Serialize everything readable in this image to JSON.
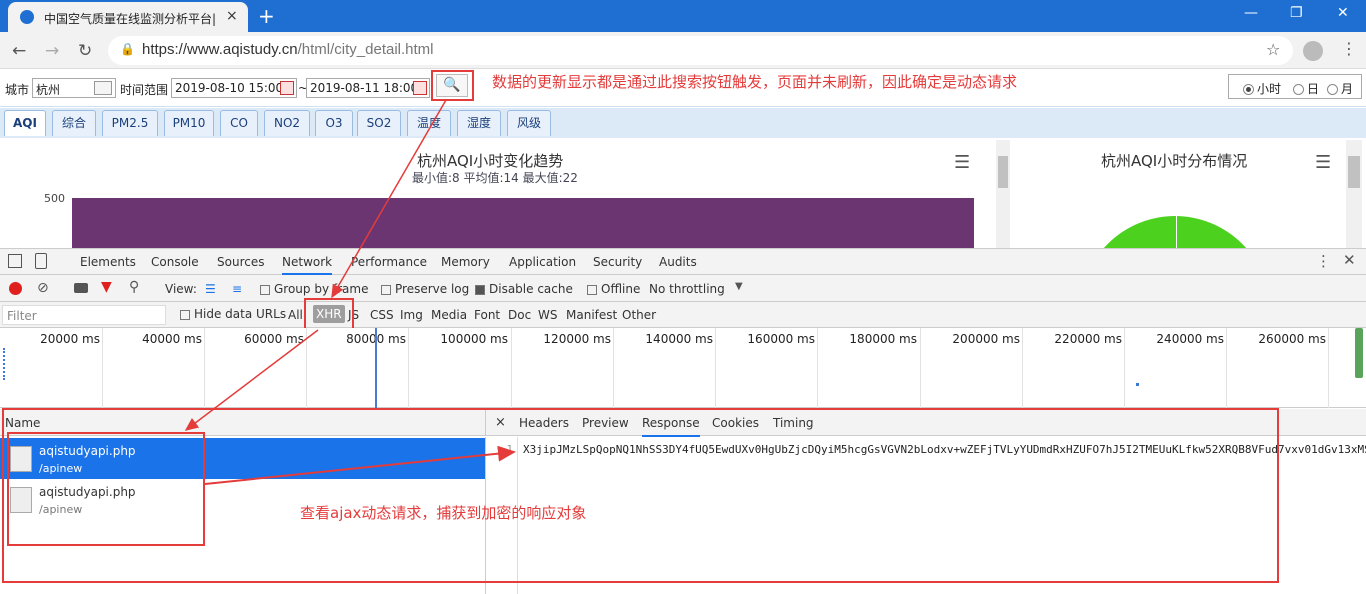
{
  "browser": {
    "tab_title": "中国空气质量在线监测分析平台|",
    "tab_close": "×",
    "new_tab": "+",
    "window_buttons": [
      "—",
      "❐",
      "✕"
    ],
    "url_host": "https://www.aqistudy.cn",
    "url_path": "/html/city_detail.html"
  },
  "filter_bar": {
    "city_label": "城市",
    "city_value": "杭州",
    "time_range_label": "时间范围",
    "start_time": "2019-08-10 15:00",
    "separator": "~",
    "end_time": "2019-08-11 18:00",
    "radio_options": [
      {
        "label": "小时",
        "checked": true
      },
      {
        "label": "日",
        "checked": false
      },
      {
        "label": "月",
        "checked": false
      }
    ]
  },
  "pollutant_tabs": [
    "AQI",
    "综合",
    "PM2.5",
    "PM10",
    "CO",
    "NO2",
    "O3",
    "SO2",
    "温度",
    "湿度",
    "风级"
  ],
  "charts": {
    "left_title": "杭州AQI小时变化趋势",
    "left_subtitle": "最小值:8 平均值:14 最大值:22",
    "left_ytick": "500",
    "right_title": "杭州AQI小时分布情况"
  },
  "devtools": {
    "tabs": [
      "Elements",
      "Console",
      "Sources",
      "Network",
      "Performance",
      "Memory",
      "Application",
      "Security",
      "Audits"
    ],
    "active_tab": "Network",
    "view_label": "View:",
    "group_by_frame": "Group by frame",
    "preserve_log": "Preserve log",
    "disable_cache": "Disable cache",
    "offline": "Offline",
    "throttling": "No throttling",
    "filter_placeholder": "Filter",
    "hide_data_urls": "Hide data URLs",
    "type_filters": [
      "All",
      "XHR",
      "JS",
      "CSS",
      "Img",
      "Media",
      "Font",
      "Doc",
      "WS",
      "Manifest",
      "Other"
    ],
    "timeline_ticks": [
      "20000 ms",
      "40000 ms",
      "60000 ms",
      "80000 ms",
      "100000 ms",
      "120000 ms",
      "140000 ms",
      "160000 ms",
      "180000 ms",
      "200000 ms",
      "220000 ms",
      "240000 ms",
      "260000 ms"
    ],
    "name_header": "Name",
    "requests": [
      {
        "name": "aqistudyapi.php",
        "path": "/apinew",
        "selected": true
      },
      {
        "name": "aqistudyapi.php",
        "path": "/apinew",
        "selected": false
      }
    ],
    "detail_close": "×",
    "detail_tabs": [
      "Headers",
      "Preview",
      "Response",
      "Cookies",
      "Timing"
    ],
    "active_detail_tab": "Response",
    "line_number": "1",
    "response_text": "X3jipJMzLSpQopNQ1NhSS3DY4fUQ5EwdUXv0HgUbZjcDQyiM5hcgGsVGVN2bLodxv+wZEFjTVLyYUDmdRxHZUFO7hJ5I2TMEUuKLfkw52XRQB8VFud7vxv01dGv13xMS"
  },
  "annotations": {
    "search_note": "数据的更新显示都是通过此搜索按钮触发，页面并未刷新，因此确定是动态请求",
    "ajax_note": "查看ajax动态请求，捕获到加密的响应对象"
  },
  "colors": {
    "accent": "#1a73e8",
    "annotation_red": "#e43b3b",
    "chart_bar": "#6b3571",
    "pie_green": "#4cd21e"
  }
}
